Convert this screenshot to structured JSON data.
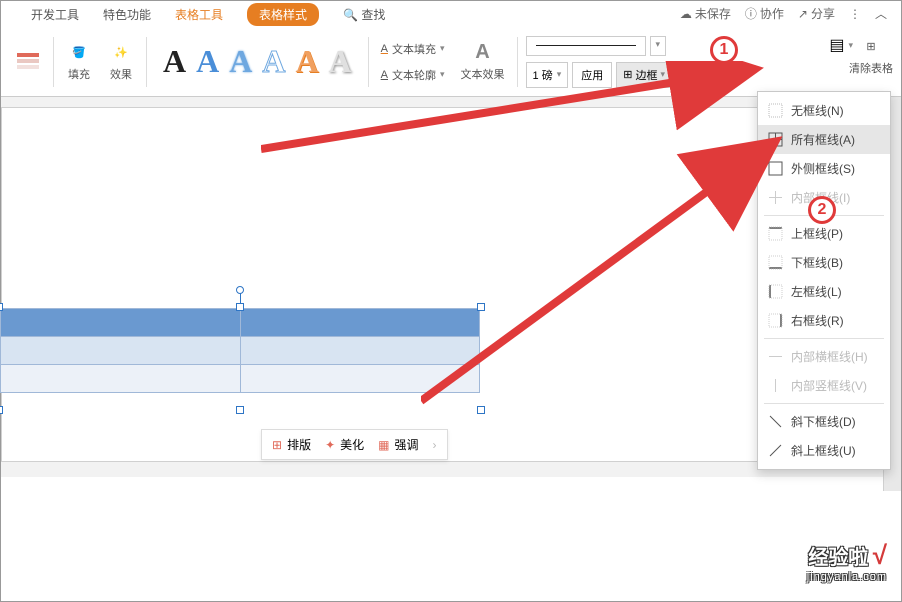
{
  "tabs": {
    "dev": "开发工具",
    "feature": "特色功能",
    "tableTools": "表格工具",
    "tableStyle": "表格样式",
    "find": "查找"
  },
  "topRight": {
    "unsaved": "未保存",
    "coop": "协作",
    "share": "分享"
  },
  "ribbon": {
    "fill": "填充",
    "effect": "效果",
    "textFill": "文本填充",
    "textOutline": "文本轮廓",
    "textEffect": "文本效果",
    "weight": "1 磅",
    "apply": "应用",
    "border": "边框",
    "clearStyle": "清除表格"
  },
  "miniBar": {
    "layout": "排版",
    "beautify": "美化",
    "emphasize": "强调"
  },
  "borderMenu": {
    "none": "无框线(N)",
    "all": "所有框线(A)",
    "outside": "外侧框线(S)",
    "inside": "内部框线(I)",
    "top": "上框线(P)",
    "bottom": "下框线(B)",
    "left": "左框线(L)",
    "right": "右框线(R)",
    "insideH": "内部横框线(H)",
    "insideV": "内部竖框线(V)",
    "diagDown": "斜下框线(D)",
    "diagUp": "斜上框线(U)"
  },
  "badges": {
    "one": "1",
    "two": "2"
  },
  "watermark": {
    "text": "经验啦",
    "check": "√",
    "url": "jingyanla.com"
  }
}
